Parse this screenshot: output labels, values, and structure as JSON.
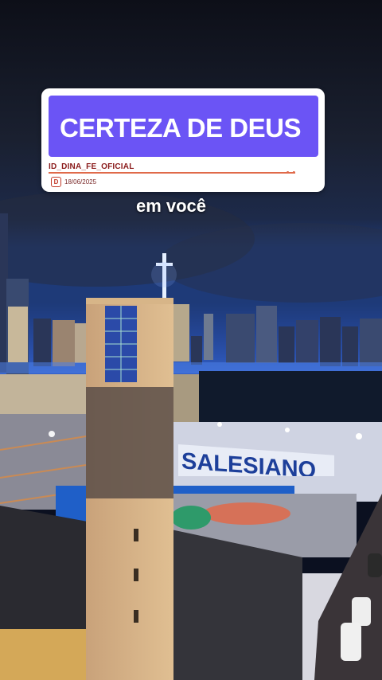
{
  "post": {
    "title": "CERTEZA DE DEUS",
    "handle": "ID_DINA_FE_OFICIAL",
    "date": "18/06/2025",
    "logo_letter": "D",
    "caption": "em você"
  },
  "scene": {
    "sign_text": "SALESIANO"
  },
  "colors": {
    "title_box": "#6b54f5",
    "card_bg": "#ffffff",
    "sky": "#0b1020"
  }
}
